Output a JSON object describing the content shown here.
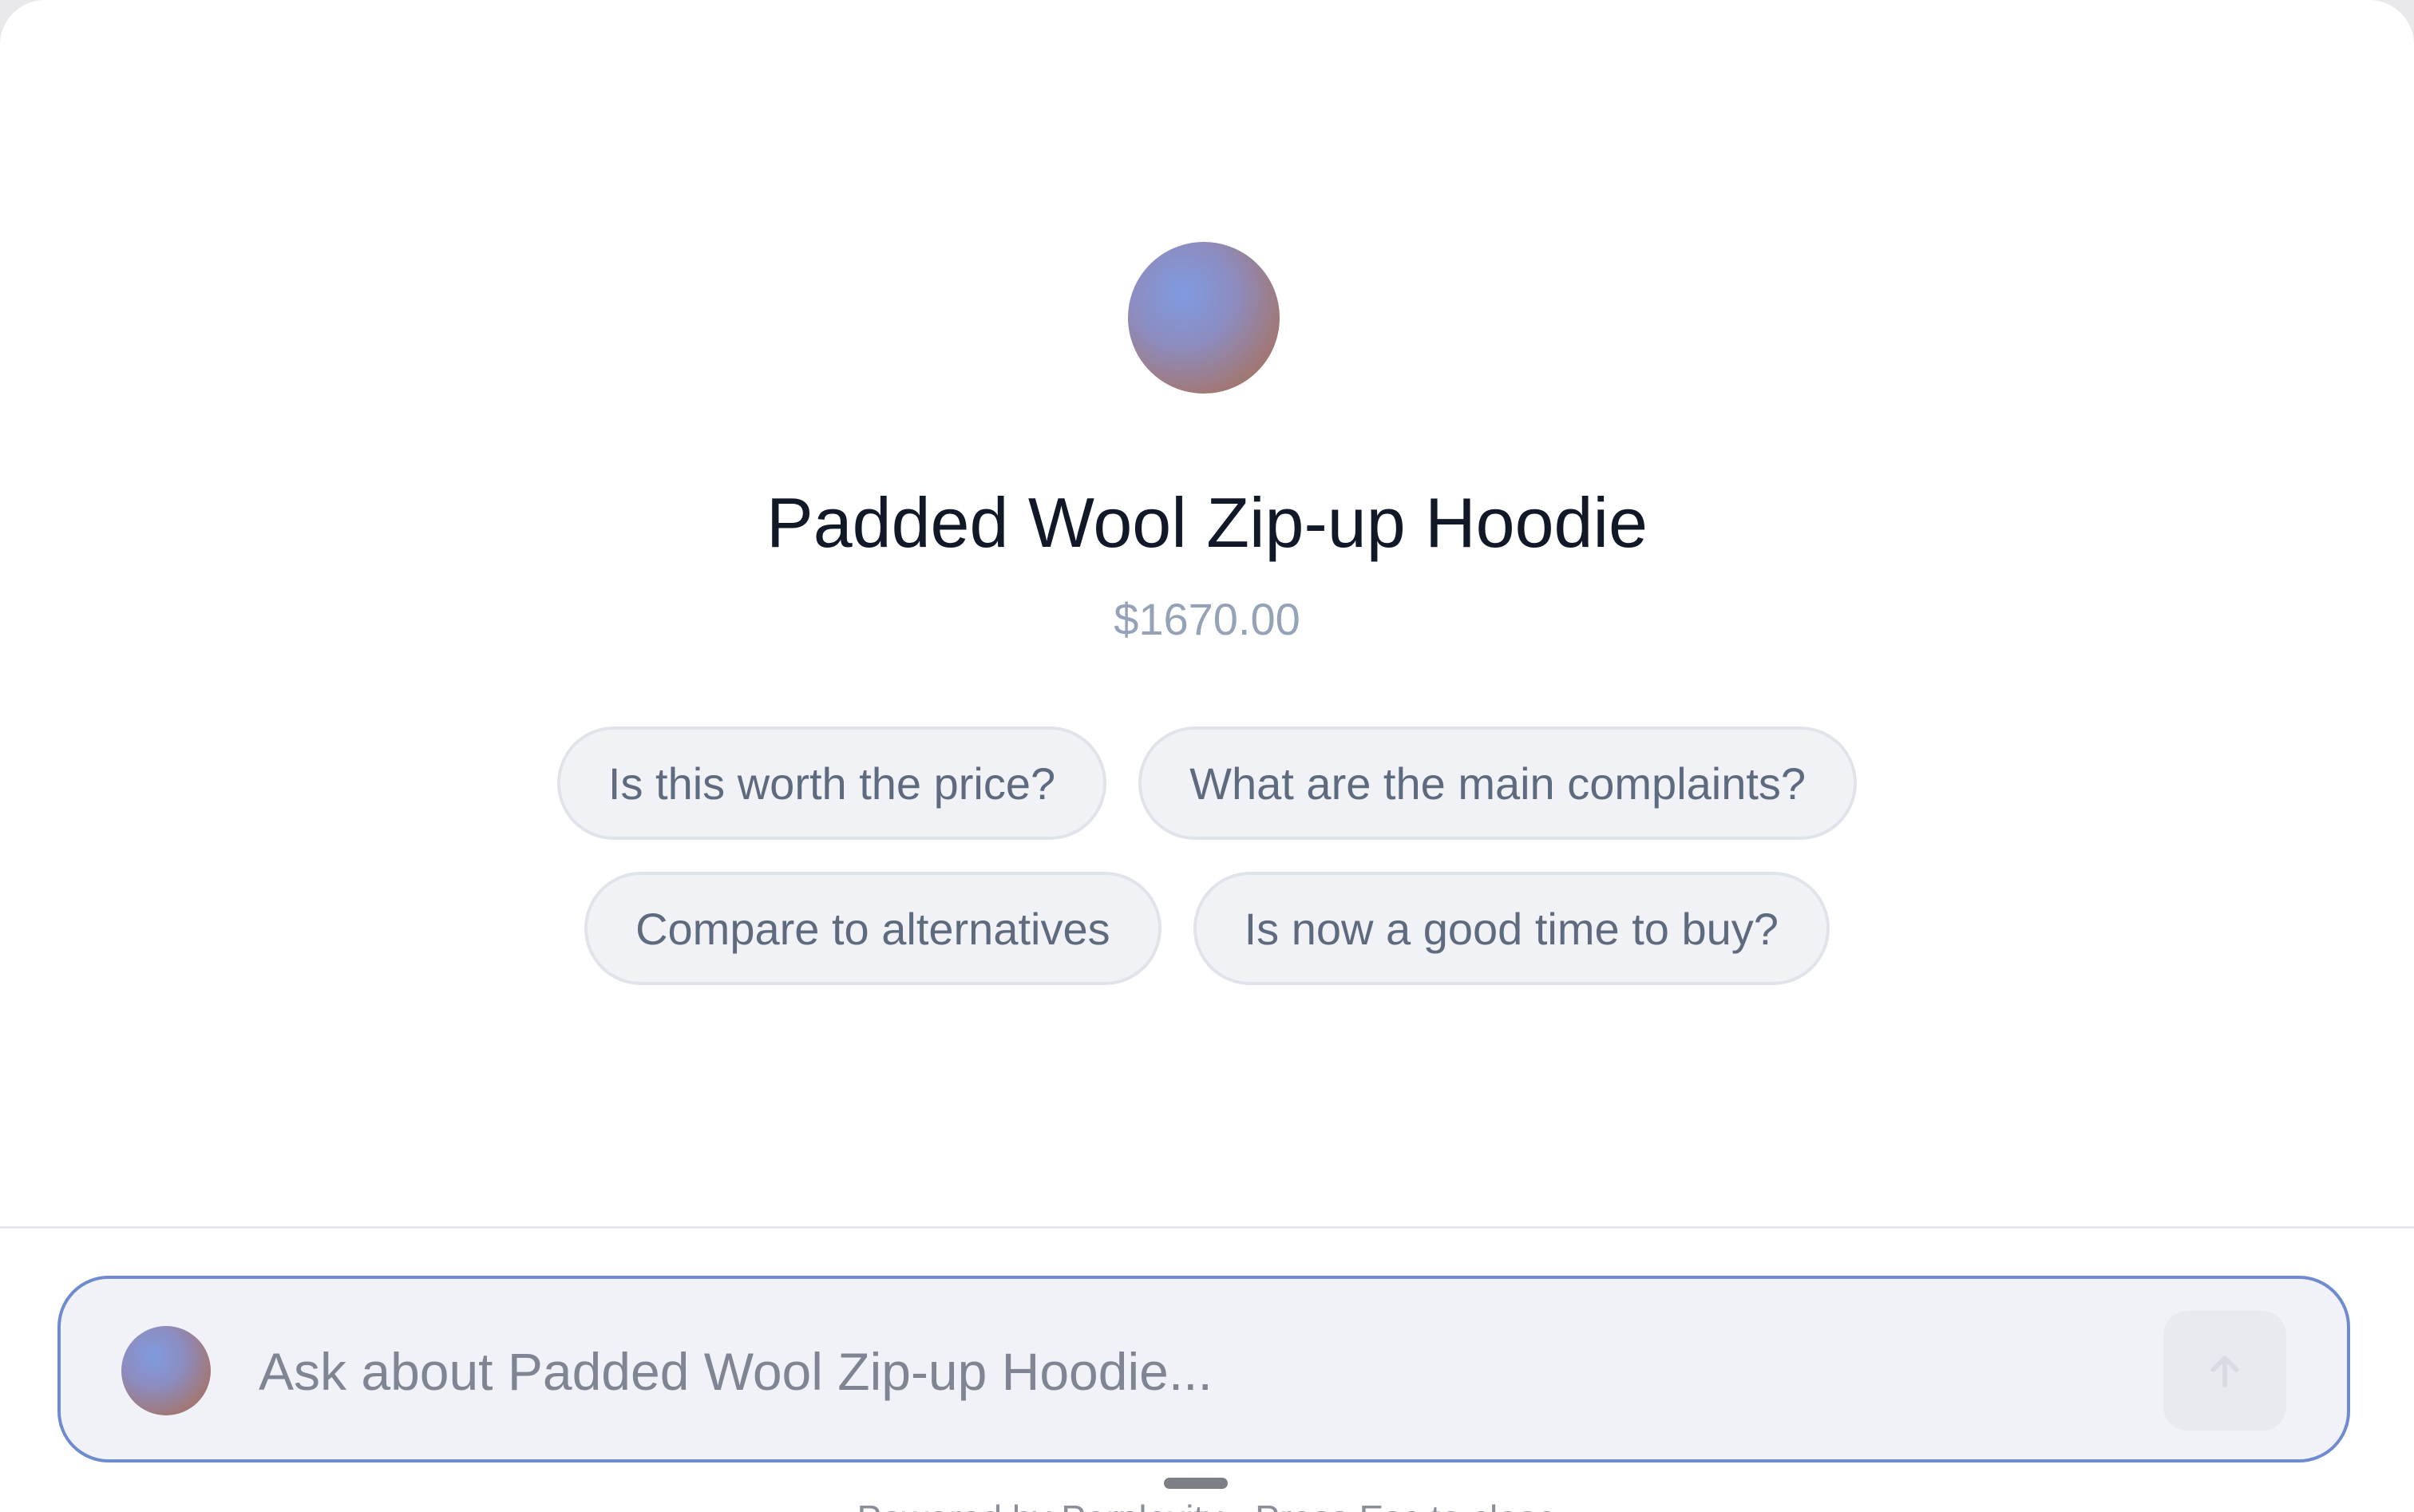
{
  "product": {
    "title": "Padded Wool Zip-up Hoodie",
    "price": "$1670.00"
  },
  "suggestions": [
    "Is this worth the price?",
    "What are the main complaints?",
    "Compare to alternatives",
    "Is now a good time to buy?"
  ],
  "input": {
    "placeholder": "Ask about Padded Wool Zip-up Hoodie...",
    "value": ""
  },
  "send_button": {
    "icon": "arrow-up-icon"
  },
  "footer": {
    "text": "Powered by Perplexity · Press Esc to close"
  },
  "colors": {
    "accent_border": "#6f8bd0",
    "title": "#111827",
    "price": "#94a3b8",
    "chip_background": "#f1f2f6",
    "chip_text": "#5e6a7e"
  }
}
